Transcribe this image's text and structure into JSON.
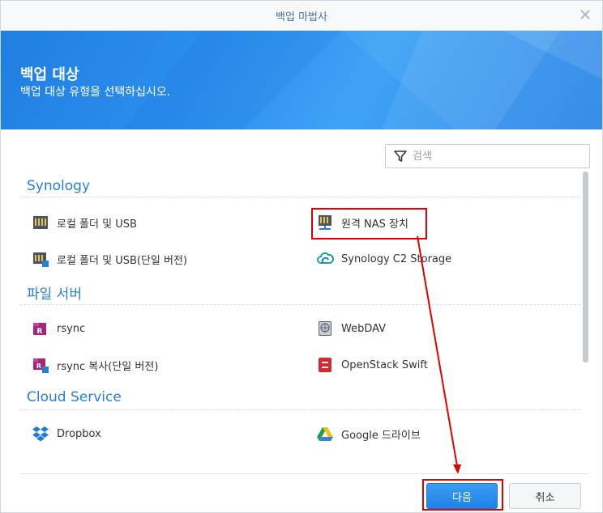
{
  "window": {
    "title": "백업 마법사"
  },
  "header": {
    "title": "백업 대상",
    "subtitle": "백업 대상 유형을 선택하십시오."
  },
  "search": {
    "placeholder": "검색"
  },
  "categories": [
    {
      "label": "Synology",
      "items": [
        {
          "label": "로컬 폴더 및 USB",
          "icon": "local-folder-icon"
        },
        {
          "label": "원격 NAS 장치",
          "icon": "remote-nas-icon"
        },
        {
          "label": "로컬 폴더 및 USB(단일 버전)",
          "icon": "local-folder-single-icon"
        },
        {
          "label": "Synology C2 Storage",
          "icon": "synology-c2-icon"
        }
      ]
    },
    {
      "label": "파일 서버",
      "items": [
        {
          "label": "rsync",
          "icon": "rsync-icon"
        },
        {
          "label": "WebDAV",
          "icon": "webdav-icon"
        },
        {
          "label": "rsync 복사(단일 버전)",
          "icon": "rsync-copy-icon"
        },
        {
          "label": "OpenStack Swift",
          "icon": "openstack-swift-icon"
        }
      ]
    },
    {
      "label": "Cloud Service",
      "items": [
        {
          "label": "Dropbox",
          "icon": "dropbox-icon"
        },
        {
          "label": "Google 드라이브",
          "icon": "google-drive-icon"
        }
      ]
    }
  ],
  "buttons": {
    "next": "다음",
    "cancel": "취소"
  },
  "colors": {
    "accent": "#2a7dd3",
    "banner": "#2b8ff0",
    "highlight": "#e10000"
  }
}
